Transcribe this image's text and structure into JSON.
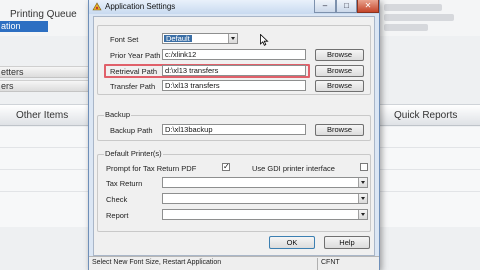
{
  "background": {
    "title": "Printing Queue",
    "selected_item": "ation",
    "strip1": "etters",
    "strip2": "ers",
    "other_items_label": "Other Items",
    "quick_reports_label": "Quick Reports"
  },
  "dialog": {
    "title": "Application Settings",
    "font_set": {
      "label": "Font Set",
      "value": "Default"
    },
    "prior_year_path": {
      "label": "Prior Year Path",
      "value": "c:/xlink12",
      "browse": "Browse"
    },
    "retrieval_path": {
      "label": "Retrieval Path",
      "value": "d:\\xl13 transfers",
      "browse": "Browse"
    },
    "transfer_path": {
      "label": "Transfer Path",
      "value": "D:\\xl13 transfers",
      "browse": "Browse"
    },
    "backup": {
      "group": "Backup",
      "label": "Backup Path",
      "value": "D:\\xl13backup",
      "browse": "Browse"
    },
    "printers": {
      "group": "Default Printer(s)",
      "prompt_label": "Prompt for Tax Return PDF",
      "prompt_checked": "✓",
      "gdi_label": "Use GDI printer interface",
      "tax_return_label": "Tax Return",
      "check_label": "Check",
      "report_label": "Report"
    },
    "ok": "OK",
    "help": "Help",
    "status": "Select New Font Size, Restart Application",
    "status_code": "CFNT"
  },
  "colors": {
    "highlight": "#e0606a",
    "selection": "#3a6ea5"
  }
}
